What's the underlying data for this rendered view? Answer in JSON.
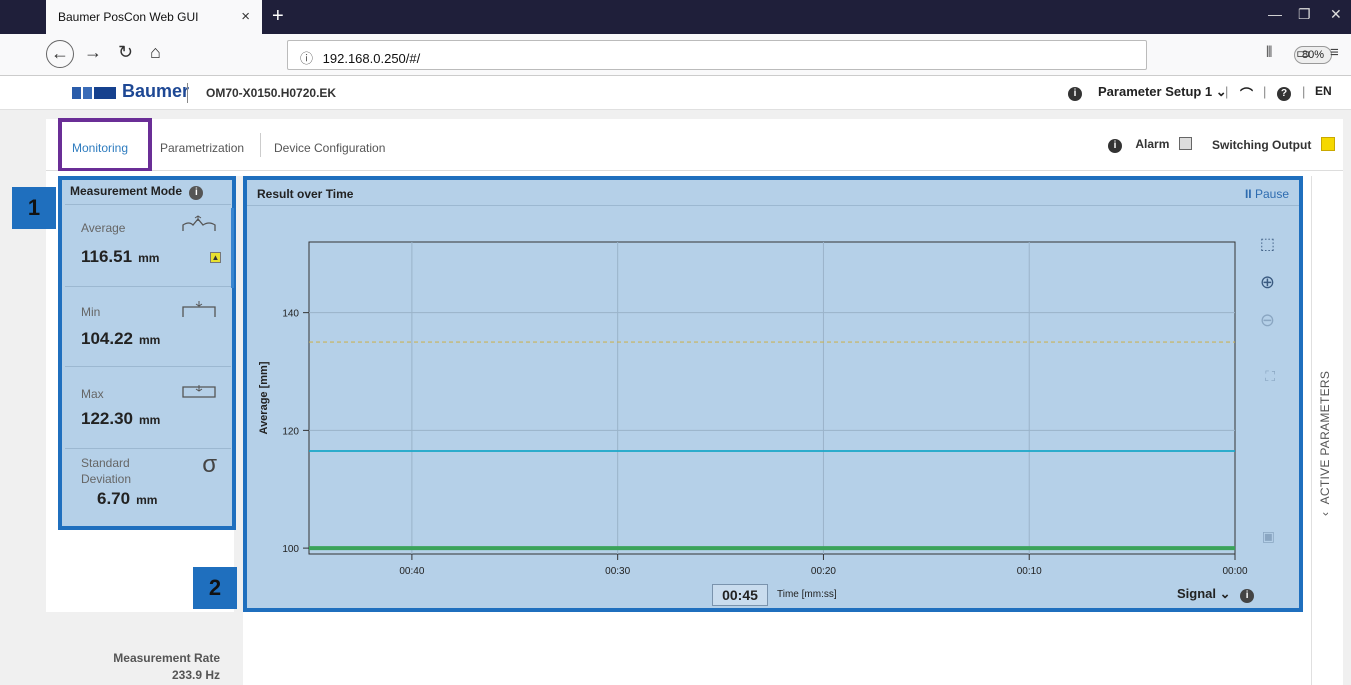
{
  "browser": {
    "tab_title": "Baumer PosCon Web GUI",
    "url": "192.168.0.250/#/",
    "zoom": "80%",
    "url_icons": "··· ♡ ☆"
  },
  "header": {
    "brand": "Baumer",
    "device_id": "OM70-X0150.H0720.EK",
    "parameter_setup": "Parameter Setup 1",
    "language": "EN"
  },
  "tabs": {
    "monitoring": "Monitoring",
    "parametrization": "Parametrization",
    "device_configuration": "Device Configuration",
    "alarm": "Alarm",
    "switching_output": "Switching Output"
  },
  "measurement_mode": {
    "title": "Measurement Mode",
    "average": {
      "label": "Average",
      "value": "116.51",
      "unit": "mm"
    },
    "min": {
      "label": "Min",
      "value": "104.22",
      "unit": "mm"
    },
    "max": {
      "label": "Max",
      "value": "122.30",
      "unit": "mm"
    },
    "std": {
      "label_line1": "Standard",
      "label_line2": "Deviation",
      "value": "6.70",
      "unit": "mm"
    }
  },
  "measurement_rate": {
    "label": "Measurement Rate",
    "value": "233.9 Hz"
  },
  "badges": {
    "one": "1",
    "two": "2"
  },
  "chart_panel": {
    "title": "Result over Time",
    "pause": "Pause",
    "time_window": "00:45",
    "time_label": "Time [mm:ss]",
    "signal": "Signal"
  },
  "right_bar": {
    "label": "ACTIVE PARAMETERS"
  },
  "chart_data": {
    "type": "line",
    "ylabel": "Average [mm]",
    "xlabel": "",
    "ylim": [
      99,
      152
    ],
    "yticks": [
      100,
      120,
      140
    ],
    "x_tick_labels": [
      "00:40",
      "00:30",
      "00:20",
      "00:10",
      "00:00"
    ],
    "x_ticks_seconds": [
      40,
      30,
      20,
      10,
      0
    ],
    "xlim": [
      45,
      0
    ],
    "threshold": 135,
    "series": [
      {
        "values": [
          116.5,
          116.5
        ],
        "x": [
          45,
          0
        ],
        "color": "#1aa7c9"
      },
      {
        "values": [
          100,
          100
        ],
        "x": [
          45,
          0
        ],
        "color": "#3aa35a"
      }
    ],
    "colors": {
      "threshold": "#c9b25a",
      "axis": "#333333",
      "grid": "#9ab3c9"
    }
  }
}
